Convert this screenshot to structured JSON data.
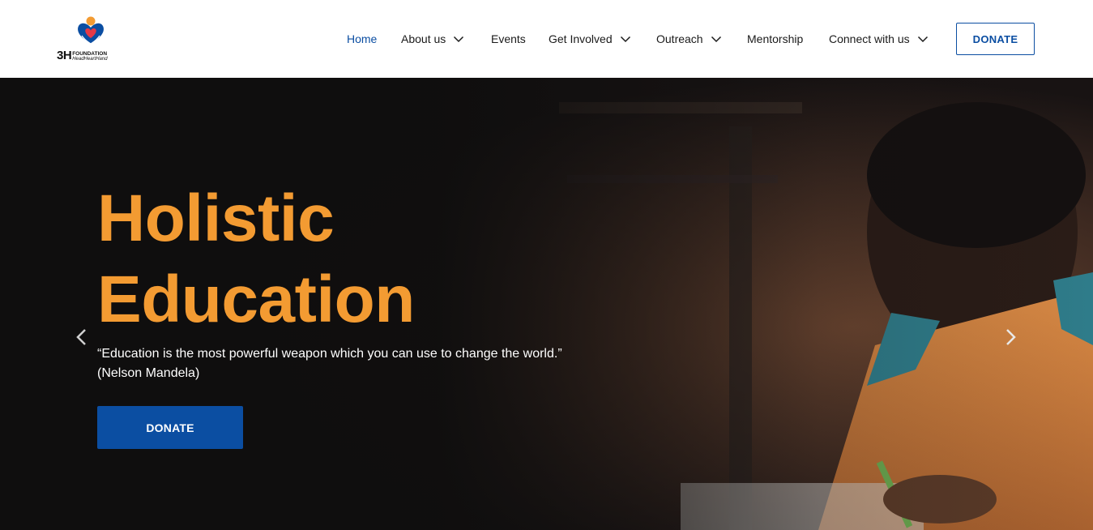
{
  "header": {
    "logo": {
      "brand_short": "3H",
      "brand_line1": "FOUNDATION",
      "brand_line2": "HeadHeartHand"
    },
    "nav": [
      {
        "label": "Home",
        "active": true,
        "has_dropdown": false
      },
      {
        "label": "About us",
        "active": false,
        "has_dropdown": true
      },
      {
        "label": "Events",
        "active": false,
        "has_dropdown": false
      },
      {
        "label": "Get Involved",
        "active": false,
        "has_dropdown": true
      },
      {
        "label": "Outreach",
        "active": false,
        "has_dropdown": true
      },
      {
        "label": "Mentorship",
        "active": false,
        "has_dropdown": false
      },
      {
        "label": "Connect with us",
        "active": false,
        "has_dropdown": true
      }
    ],
    "donate_label": "DONATE"
  },
  "hero": {
    "title_line1": "Holistic",
    "title_line2": "Education",
    "quote_line1": "“Education is the most powerful weapon which you can use to change the world.”",
    "quote_line2": "(Nelson Mandela)",
    "donate_label": "DONATE",
    "prev_icon": "chevron-left-icon",
    "next_icon": "chevron-right-icon"
  },
  "colors": {
    "accent_blue": "#0b4ea2",
    "title_orange": "#f39b32",
    "hero_background": "#0f0e0e",
    "text_dark": "#1a1a1a"
  }
}
